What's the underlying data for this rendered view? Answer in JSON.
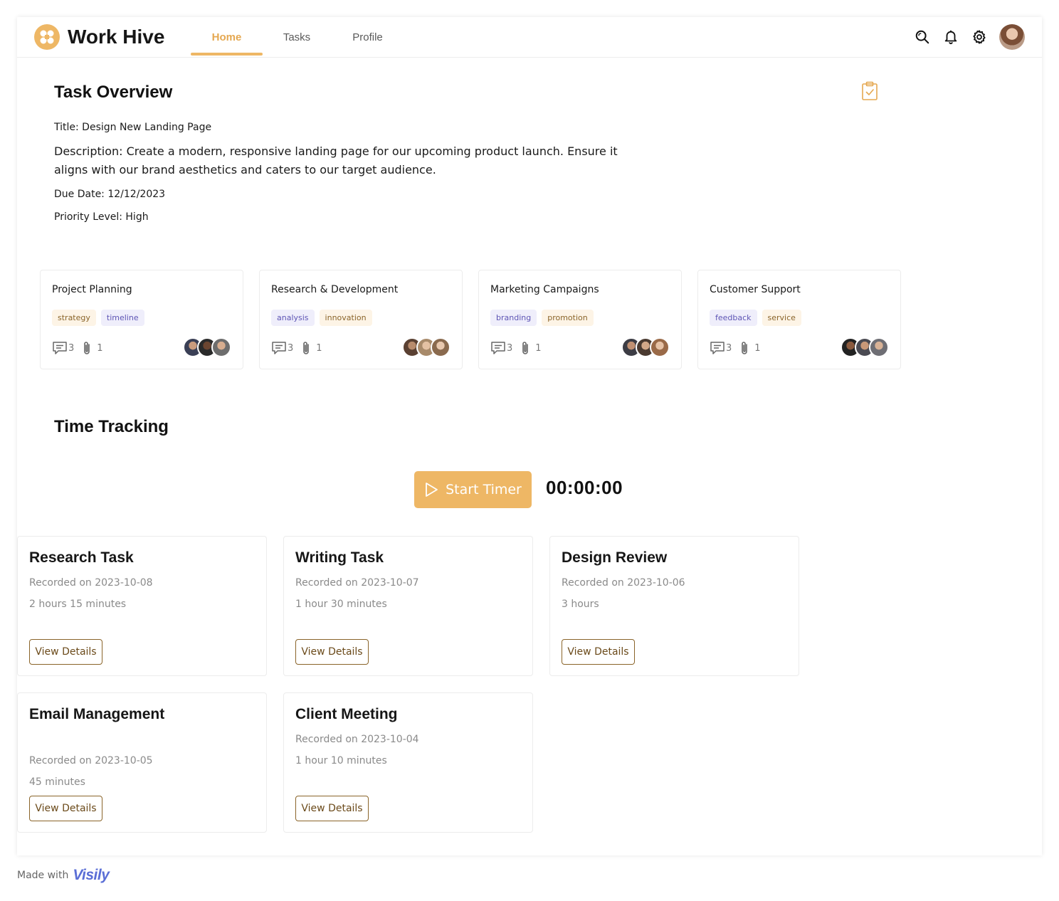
{
  "app": {
    "name": "Work Hive",
    "accent": "#eeb765"
  },
  "nav": [
    {
      "label": "Home",
      "active": true
    },
    {
      "label": "Tasks",
      "active": false
    },
    {
      "label": "Profile",
      "active": false
    }
  ],
  "header_icons": [
    "search-icon",
    "bell-icon",
    "gear-icon",
    "user-avatar"
  ],
  "overview": {
    "heading": "Task Overview",
    "title_line": "Title: Design New Landing Page",
    "description": "Description: Create a modern, responsive landing page for our upcoming product launch. Ensure it aligns with our brand aesthetics and caters to our target audience.",
    "due_line": "Due Date: 12/12/2023",
    "priority_line": "Priority Level: High"
  },
  "categories": [
    {
      "title": "Project Planning",
      "tags": [
        "strategy",
        "timeline"
      ],
      "comments": "3",
      "attachments": "1"
    },
    {
      "title": "Research & Development",
      "tags": [
        "analysis",
        "innovation"
      ],
      "comments": "3",
      "attachments": "1"
    },
    {
      "title": "Marketing Campaigns",
      "tags": [
        "branding",
        "promotion"
      ],
      "comments": "3",
      "attachments": "1"
    },
    {
      "title": "Customer Support",
      "tags": [
        "feedback",
        "service"
      ],
      "comments": "3",
      "attachments": "1"
    }
  ],
  "time_tracking": {
    "heading": "Time Tracking",
    "start_label": "Start Timer",
    "timer": "00:00:00",
    "view_label": "View Details",
    "records": [
      {
        "title": "Research Task",
        "recorded": "Recorded on 2023-10-08",
        "duration": "2 hours 15 minutes"
      },
      {
        "title": "Writing Task",
        "recorded": "Recorded on 2023-10-07",
        "duration": "1 hour 30 minutes"
      },
      {
        "title": "Design Review",
        "recorded": "Recorded on 2023-10-06",
        "duration": "3 hours"
      },
      {
        "title": "Email Management",
        "recorded": "Recorded on 2023-10-05",
        "duration": "45 minutes"
      },
      {
        "title": "Client Meeting",
        "recorded": "Recorded on 2023-10-04",
        "duration": "1 hour 10 minutes"
      }
    ]
  },
  "footer": {
    "made_with": "Made with",
    "brand": "Visily"
  }
}
